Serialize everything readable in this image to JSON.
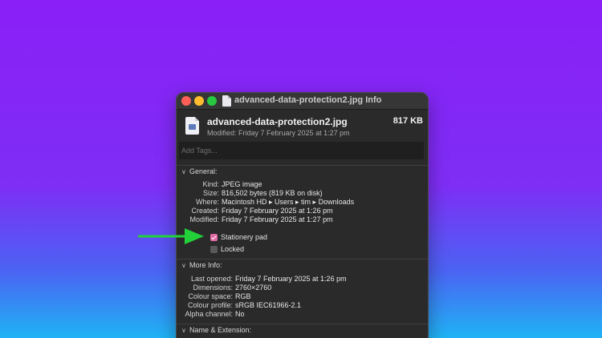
{
  "window": {
    "title": "advanced-data-protection2.jpg Info"
  },
  "header": {
    "file_name": "advanced-data-protection2.jpg",
    "file_size": "817 KB",
    "modified_line": "Modified: Friday 7 February 2025 at 1:27 pm"
  },
  "tags": {
    "placeholder": "Add Tags..."
  },
  "general": {
    "heading": "General:",
    "rows": [
      {
        "label": "Kind:",
        "value": "JPEG image"
      },
      {
        "label": "Size:",
        "value": "816,502 bytes (819 KB on disk)"
      },
      {
        "label": "Where:",
        "value": "Macintosh HD ▸ Users ▸ tim ▸ Downloads"
      },
      {
        "label": "Created:",
        "value": "Friday 7 February 2025 at 1:26 pm"
      },
      {
        "label": "Modified:",
        "value": "Friday 7 February 2025 at 1:27 pm"
      }
    ],
    "stationery_label": "Stationery pad",
    "stationery_checked": true,
    "locked_label": "Locked",
    "locked_checked": false
  },
  "more_info": {
    "heading": "More Info:",
    "rows": [
      {
        "label": "Last opened:",
        "value": "Friday 7 February 2025 at 1:26 pm"
      },
      {
        "label": "Dimensions:",
        "value": "2760×2760"
      },
      {
        "label": "Colour space:",
        "value": "RGB"
      },
      {
        "label": "Colour profile:",
        "value": "sRGB IEC61966-2.1"
      },
      {
        "label": "Alpha channel:",
        "value": "No"
      }
    ]
  },
  "name_extension": {
    "heading": "Name & Extension:"
  },
  "icons": {
    "section_toggle": "chevron-down-icon",
    "file": "jpeg-document-icon",
    "annotation": "green-arrow-icon"
  },
  "colors": {
    "arrow": "#22d13a",
    "checkbox_checked": "#e06aa6",
    "close": "#ff5f57",
    "minimize": "#febc2e",
    "zoom": "#28c840"
  }
}
